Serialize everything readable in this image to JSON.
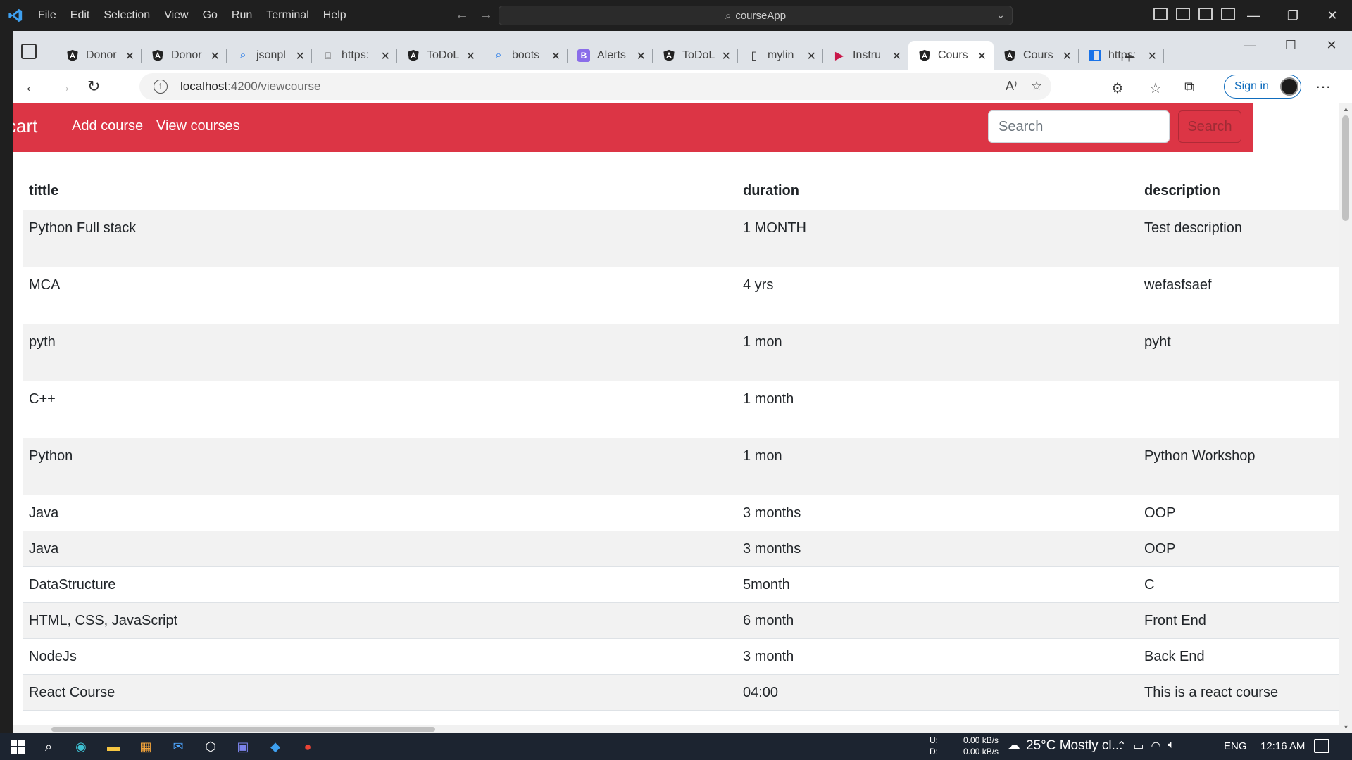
{
  "vscode": {
    "menu": [
      "File",
      "Edit",
      "Selection",
      "View",
      "Go",
      "Run",
      "Terminal",
      "Help"
    ],
    "command_center": "courseApp"
  },
  "browser": {
    "tabs": [
      {
        "title": "Donor",
        "icon": "angular-icon"
      },
      {
        "title": "Donor",
        "icon": "angular-icon"
      },
      {
        "title": "jsonpl",
        "icon": "search-icon"
      },
      {
        "title": "https:",
        "icon": "page-icon"
      },
      {
        "title": "ToDoL",
        "icon": "angular-icon"
      },
      {
        "title": "boots",
        "icon": "search-icon"
      },
      {
        "title": "Alerts",
        "icon": "bootstrap-icon"
      },
      {
        "title": "ToDoL",
        "icon": "angular-icon"
      },
      {
        "title": "mylin",
        "icon": "document-icon"
      },
      {
        "title": "Instru",
        "icon": "play-icon"
      },
      {
        "title": "Cours",
        "icon": "angular-icon"
      },
      {
        "title": "Cours",
        "icon": "angular-icon"
      },
      {
        "title": "https:",
        "icon": "window-icon"
      }
    ],
    "address": {
      "host": "localhost",
      "path": ":4200/viewcourse"
    },
    "signin_label": "Sign in"
  },
  "app": {
    "brand": "cart",
    "nav": [
      "Add course",
      "View courses"
    ],
    "search_placeholder": "Search",
    "search_button": "Search",
    "theme_color": "#dc3545"
  },
  "table": {
    "headers": [
      "tittle",
      "duration",
      "description"
    ],
    "rows": [
      [
        "Python Full stack",
        "1 MONTH",
        "Test description"
      ],
      [
        "MCA",
        "4 yrs",
        "wefasfsaef"
      ],
      [
        "pyth",
        "1 mon",
        "pyht"
      ],
      [
        "C++",
        "1 month",
        ""
      ],
      [
        "Python",
        "1 mon",
        "Python Workshop"
      ],
      [
        "Java",
        "3 months",
        "OOP"
      ],
      [
        "Java",
        "3 months",
        "OOP"
      ],
      [
        "DataStructure",
        "5month",
        "C"
      ],
      [
        "HTML, CSS, JavaScript",
        "6 month",
        "Front End"
      ],
      [
        "NodeJs",
        "3 month",
        "Back End"
      ],
      [
        "React Course",
        "04:00",
        "This is a react course"
      ]
    ]
  },
  "taskbar": {
    "net_labels": [
      "U:",
      "D:"
    ],
    "net_values": [
      "0.00 kB/s",
      "0.00 kB/s"
    ],
    "weather": "25°C  Mostly cl...",
    "lang": "ENG",
    "time": "12:16 AM"
  }
}
